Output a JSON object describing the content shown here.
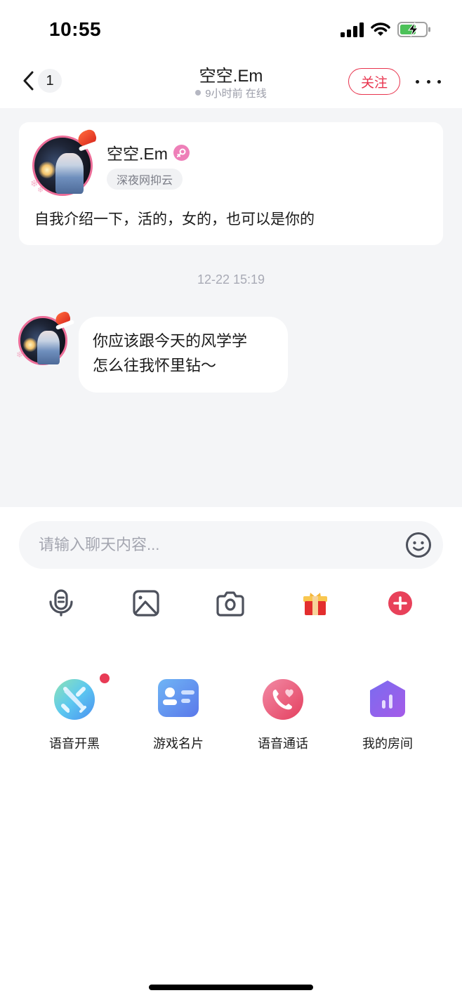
{
  "status_bar": {
    "time": "10:55",
    "icons": [
      "signal-icon",
      "wifi-icon",
      "battery-charging-icon"
    ]
  },
  "nav": {
    "back_icon": "chevron-left-icon",
    "unread_count": "1",
    "title": "空空.Em",
    "subtitle": "9小时前 在线",
    "follow_label": "关注",
    "more_icon": "more-icon"
  },
  "profile_card": {
    "name": "空空.Em",
    "gender_icon": "female-icon",
    "tag": "深夜网抑云",
    "bio": "自我介绍一下，活的，女的，也可以是你的"
  },
  "messages": [
    {
      "timestamp": "12-22 15:19",
      "sender": "空空.Em",
      "text_lines": [
        "你应该跟今天的风学学",
        "怎么往我怀里钻～"
      ]
    }
  ],
  "composer": {
    "placeholder": "请输入聊天内容...",
    "value": "",
    "emoji_icon": "emoji-icon"
  },
  "toolbar": {
    "items": [
      {
        "name": "voice",
        "icon": "microphone-icon"
      },
      {
        "name": "image",
        "icon": "image-icon"
      },
      {
        "name": "camera",
        "icon": "camera-icon"
      },
      {
        "name": "gift",
        "icon": "gift-icon"
      },
      {
        "name": "more",
        "icon": "plus-circle-icon"
      }
    ]
  },
  "features": [
    {
      "label": "语音开黑",
      "icon": "crossed-swords-icon",
      "badge": true
    },
    {
      "label": "游戏名片",
      "icon": "id-card-icon",
      "badge": false
    },
    {
      "label": "语音通话",
      "icon": "phone-heart-icon",
      "badge": false
    },
    {
      "label": "我的房间",
      "icon": "room-icon",
      "badge": false
    }
  ],
  "colors": {
    "accent_red": "#e8344e",
    "chat_bg": "#f4f5f7",
    "muted_text": "#a8aab5",
    "avatar_ring": "#ec6d98"
  }
}
